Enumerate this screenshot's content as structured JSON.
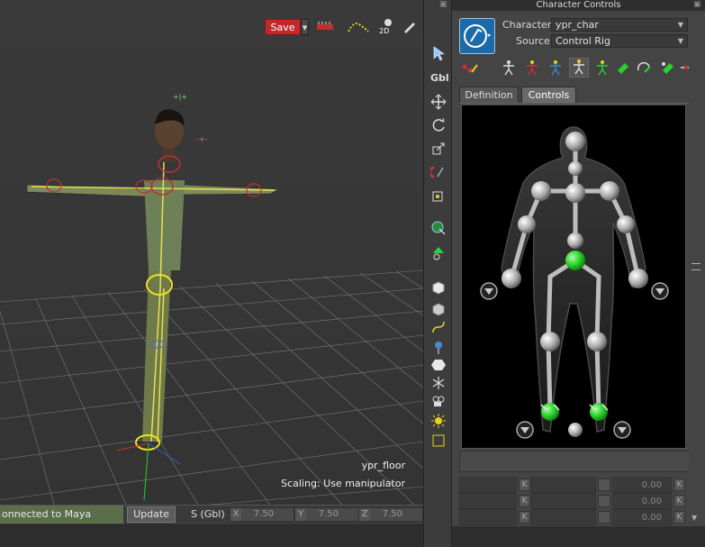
{
  "panel": {
    "title": "Character Controls",
    "character_label": "Character:",
    "character_value": "ypr_char",
    "source_label": "Source:",
    "source_value": "Control Rig",
    "tabs": [
      {
        "label": "Definition"
      },
      {
        "label": "Controls"
      }
    ],
    "active_tab": "Controls"
  },
  "viewport": {
    "save_label": "Save",
    "object_label": "ypr_floor",
    "scaling_text": "Scaling: Use manipulator",
    "toolbar_2d_label": "2D",
    "gbl_label": "Gbl"
  },
  "status": {
    "connection": "onnected to Maya",
    "update_label": "Update",
    "mode": "S (Gbl)",
    "axes": [
      {
        "axis": "X",
        "value": "7.50"
      },
      {
        "axis": "Y",
        "value": "7.50"
      },
      {
        "axis": "Z",
        "value": "7.50"
      }
    ]
  },
  "attributes": [
    {
      "key": "K",
      "value": "0.00",
      "key2": "K"
    },
    {
      "key": "K",
      "value": "0.00",
      "key2": "K"
    },
    {
      "key": "K",
      "value": "0.00",
      "key2": "K"
    }
  ],
  "colors": {
    "save_button": "#c0282c",
    "connection_bar": "#5a6e4a",
    "rig_active_joint": "#22cc22",
    "skeleton_highlight": "#f0e020"
  }
}
